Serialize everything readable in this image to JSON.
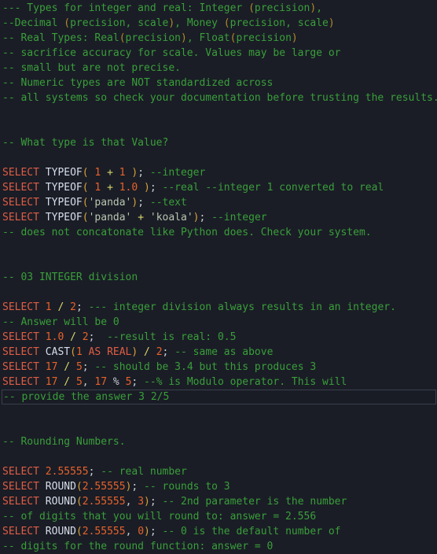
{
  "editor": {
    "app": "sql-code-editor",
    "language": "sql",
    "background_color": "#1a1d26",
    "active_line_index": 27,
    "colors": {
      "comment": "#3a9f3a",
      "keyword": "#e05d44",
      "function": "#d8dee9",
      "number": "#e8622a",
      "punctuation": "#d8a13a",
      "operator": "#d8d86a",
      "semicolon": "#c8cdd6",
      "string": "#b9c6b0",
      "active_line_border": "#3a3f4b"
    }
  },
  "lines": [
    {
      "n": 1,
      "text": "--- Types for integer and real: Integer (precision),",
      "tokens": [
        {
          "t": "--- Types for integer and real: Integer ",
          "c": "cmt"
        },
        {
          "t": "(",
          "c": "cmt-punc"
        },
        {
          "t": "precision",
          "c": "cmt"
        },
        {
          "t": ")",
          "c": "cmt-punc"
        },
        {
          "t": ",",
          "c": "cmt"
        }
      ]
    },
    {
      "n": 2,
      "text": "--Decimal (precision, scale), Money (precision, scale)",
      "tokens": [
        {
          "t": "--Decimal ",
          "c": "cmt"
        },
        {
          "t": "(",
          "c": "cmt-punc"
        },
        {
          "t": "precision, scale",
          "c": "cmt"
        },
        {
          "t": ")",
          "c": "cmt-punc"
        },
        {
          "t": ", Money ",
          "c": "cmt"
        },
        {
          "t": "(",
          "c": "cmt-punc"
        },
        {
          "t": "precision, scale",
          "c": "cmt"
        },
        {
          "t": ")",
          "c": "cmt-punc"
        }
      ]
    },
    {
      "n": 3,
      "text": "-- Real Types: Real(precision), Float(precision)",
      "tokens": [
        {
          "t": "-- Real Types: Real",
          "c": "cmt"
        },
        {
          "t": "(",
          "c": "cmt-punc"
        },
        {
          "t": "precision",
          "c": "cmt"
        },
        {
          "t": ")",
          "c": "cmt-punc"
        },
        {
          "t": ", Float",
          "c": "cmt"
        },
        {
          "t": "(",
          "c": "cmt-punc"
        },
        {
          "t": "precision",
          "c": "cmt"
        },
        {
          "t": ")",
          "c": "cmt-punc"
        }
      ]
    },
    {
      "n": 4,
      "text": "-- sacrifice accuracy for scale. Values may be large or",
      "tokens": [
        {
          "t": "-- sacrifice accuracy for scale. Values may be large or",
          "c": "cmt"
        }
      ]
    },
    {
      "n": 5,
      "text": "-- small but are not precise.",
      "tokens": [
        {
          "t": "-- small but are not precise.",
          "c": "cmt"
        }
      ]
    },
    {
      "n": 6,
      "text": "-- Numeric types are NOT standardized across",
      "tokens": [
        {
          "t": "-- Numeric types are NOT standardized across",
          "c": "cmt"
        }
      ]
    },
    {
      "n": 7,
      "text": "-- all systems so check your documentation before trusting the results.",
      "tokens": [
        {
          "t": "-- all systems so check your documentation before trusting the results.",
          "c": "cmt"
        }
      ]
    },
    {
      "n": 8,
      "text": "",
      "tokens": []
    },
    {
      "n": 9,
      "text": "",
      "tokens": []
    },
    {
      "n": 10,
      "text": "-- What type is that Value?",
      "tokens": [
        {
          "t": "-- What type is that Value?",
          "c": "cmt"
        }
      ]
    },
    {
      "n": 11,
      "text": "",
      "tokens": []
    },
    {
      "n": 12,
      "text": "SELECT TYPEOF( 1 + 1 ); --integer",
      "tokens": [
        {
          "t": "SELECT",
          "c": "kw"
        },
        {
          "t": " TYPEOF",
          "c": "fn"
        },
        {
          "t": "(",
          "c": "punc"
        },
        {
          "t": " ",
          "c": "plain"
        },
        {
          "t": "1",
          "c": "num"
        },
        {
          "t": " ",
          "c": "plain"
        },
        {
          "t": "+",
          "c": "op"
        },
        {
          "t": " ",
          "c": "plain"
        },
        {
          "t": "1",
          "c": "num"
        },
        {
          "t": " ",
          "c": "plain"
        },
        {
          "t": ")",
          "c": "punc"
        },
        {
          "t": ";",
          "c": "semi"
        },
        {
          "t": " ",
          "c": "plain"
        },
        {
          "t": "--integer",
          "c": "cmt"
        }
      ]
    },
    {
      "n": 13,
      "text": "SELECT TYPEOF( 1 + 1.0 ); --real --integer 1 converted to real",
      "tokens": [
        {
          "t": "SELECT",
          "c": "kw"
        },
        {
          "t": " TYPEOF",
          "c": "fn"
        },
        {
          "t": "(",
          "c": "punc"
        },
        {
          "t": " ",
          "c": "plain"
        },
        {
          "t": "1",
          "c": "num"
        },
        {
          "t": " ",
          "c": "plain"
        },
        {
          "t": "+",
          "c": "op"
        },
        {
          "t": " ",
          "c": "plain"
        },
        {
          "t": "1.0",
          "c": "num"
        },
        {
          "t": " ",
          "c": "plain"
        },
        {
          "t": ")",
          "c": "punc"
        },
        {
          "t": ";",
          "c": "semi"
        },
        {
          "t": " ",
          "c": "plain"
        },
        {
          "t": "--real --integer 1 converted to real",
          "c": "cmt"
        }
      ]
    },
    {
      "n": 14,
      "text": "SELECT TYPEOF('panda'); --text",
      "tokens": [
        {
          "t": "SELECT",
          "c": "kw"
        },
        {
          "t": " TYPEOF",
          "c": "fn"
        },
        {
          "t": "(",
          "c": "punc"
        },
        {
          "t": "'panda'",
          "c": "str"
        },
        {
          "t": ")",
          "c": "punc"
        },
        {
          "t": ";",
          "c": "semi"
        },
        {
          "t": " ",
          "c": "plain"
        },
        {
          "t": "--text",
          "c": "cmt"
        }
      ]
    },
    {
      "n": 15,
      "text": "SELECT TYPEOF('panda' + 'koala'); --integer",
      "tokens": [
        {
          "t": "SELECT",
          "c": "kw"
        },
        {
          "t": " TYPEOF",
          "c": "fn"
        },
        {
          "t": "(",
          "c": "punc"
        },
        {
          "t": "'panda'",
          "c": "str"
        },
        {
          "t": " ",
          "c": "plain"
        },
        {
          "t": "+",
          "c": "op"
        },
        {
          "t": " ",
          "c": "plain"
        },
        {
          "t": "'koala'",
          "c": "str"
        },
        {
          "t": ")",
          "c": "punc"
        },
        {
          "t": ";",
          "c": "semi"
        },
        {
          "t": " ",
          "c": "plain"
        },
        {
          "t": "--integer",
          "c": "cmt"
        }
      ]
    },
    {
      "n": 16,
      "text": "-- does not concatonate like Python does. Check your system.",
      "tokens": [
        {
          "t": "-- does not concatonate like Python does. Check your system.",
          "c": "cmt"
        }
      ]
    },
    {
      "n": 17,
      "text": "",
      "tokens": []
    },
    {
      "n": 18,
      "text": "",
      "tokens": []
    },
    {
      "n": 19,
      "text": "-- 03 INTEGER division",
      "tokens": [
        {
          "t": "-- 03 INTEGER division",
          "c": "cmt"
        }
      ]
    },
    {
      "n": 20,
      "text": "",
      "tokens": []
    },
    {
      "n": 21,
      "text": "SELECT 1 / 2; --- integer division always results in an integer.",
      "tokens": [
        {
          "t": "SELECT",
          "c": "kw"
        },
        {
          "t": " ",
          "c": "plain"
        },
        {
          "t": "1",
          "c": "num"
        },
        {
          "t": " ",
          "c": "plain"
        },
        {
          "t": "/",
          "c": "op"
        },
        {
          "t": " ",
          "c": "plain"
        },
        {
          "t": "2",
          "c": "num"
        },
        {
          "t": ";",
          "c": "semi"
        },
        {
          "t": " ",
          "c": "plain"
        },
        {
          "t": "--- integer division always results in an integer.",
          "c": "cmt"
        }
      ]
    },
    {
      "n": 22,
      "text": "-- Answer will be 0",
      "tokens": [
        {
          "t": "-- Answer will be 0",
          "c": "cmt"
        }
      ]
    },
    {
      "n": 23,
      "text": "SELECT 1.0 / 2;  --result is real: 0.5",
      "tokens": [
        {
          "t": "SELECT",
          "c": "kw"
        },
        {
          "t": " ",
          "c": "plain"
        },
        {
          "t": "1.0",
          "c": "num"
        },
        {
          "t": " ",
          "c": "plain"
        },
        {
          "t": "/",
          "c": "op"
        },
        {
          "t": " ",
          "c": "plain"
        },
        {
          "t": "2",
          "c": "num"
        },
        {
          "t": ";",
          "c": "semi"
        },
        {
          "t": "  ",
          "c": "plain"
        },
        {
          "t": "--result is real: 0.5",
          "c": "cmt"
        }
      ]
    },
    {
      "n": 24,
      "text": "SELECT CAST(1 AS REAL) / 2; -- same as above",
      "tokens": [
        {
          "t": "SELECT",
          "c": "kw"
        },
        {
          "t": " CAST",
          "c": "fn"
        },
        {
          "t": "(",
          "c": "punc"
        },
        {
          "t": "1",
          "c": "num"
        },
        {
          "t": " ",
          "c": "plain"
        },
        {
          "t": "AS REAL",
          "c": "kw"
        },
        {
          "t": ")",
          "c": "punc"
        },
        {
          "t": " ",
          "c": "plain"
        },
        {
          "t": "/",
          "c": "op"
        },
        {
          "t": " ",
          "c": "plain"
        },
        {
          "t": "2",
          "c": "num"
        },
        {
          "t": ";",
          "c": "semi"
        },
        {
          "t": " ",
          "c": "plain"
        },
        {
          "t": "-- same as above",
          "c": "cmt"
        }
      ]
    },
    {
      "n": 25,
      "text": "SELECT 17 / 5; -- should be 3.4 but this produces 3",
      "tokens": [
        {
          "t": "SELECT",
          "c": "kw"
        },
        {
          "t": " ",
          "c": "plain"
        },
        {
          "t": "17",
          "c": "num"
        },
        {
          "t": " ",
          "c": "plain"
        },
        {
          "t": "/",
          "c": "op"
        },
        {
          "t": " ",
          "c": "plain"
        },
        {
          "t": "5",
          "c": "num"
        },
        {
          "t": ";",
          "c": "semi"
        },
        {
          "t": " ",
          "c": "plain"
        },
        {
          "t": "-- should be 3.4 but this produces 3",
          "c": "cmt"
        }
      ]
    },
    {
      "n": 26,
      "text": "SELECT 17 / 5, 17 % 5; --% is Modulo operator. This will",
      "tokens": [
        {
          "t": "SELECT",
          "c": "kw"
        },
        {
          "t": " ",
          "c": "plain"
        },
        {
          "t": "17",
          "c": "num"
        },
        {
          "t": " ",
          "c": "plain"
        },
        {
          "t": "/",
          "c": "op"
        },
        {
          "t": " ",
          "c": "plain"
        },
        {
          "t": "5",
          "c": "num"
        },
        {
          "t": ", ",
          "c": "semi"
        },
        {
          "t": "17",
          "c": "num"
        },
        {
          "t": " ",
          "c": "plain"
        },
        {
          "t": "%",
          "c": "semi"
        },
        {
          "t": " ",
          "c": "plain"
        },
        {
          "t": "5",
          "c": "num"
        },
        {
          "t": ";",
          "c": "semi"
        },
        {
          "t": " ",
          "c": "plain"
        },
        {
          "t": "--% is Modulo operator. This will",
          "c": "cmt"
        }
      ]
    },
    {
      "n": 27,
      "text": "-- provide the answer 3 2/5",
      "active": true,
      "tokens": [
        {
          "t": "-- provide the answer 3 2/5",
          "c": "cmt"
        }
      ]
    },
    {
      "n": 28,
      "text": "",
      "tokens": []
    },
    {
      "n": 29,
      "text": "",
      "tokens": []
    },
    {
      "n": 30,
      "text": "-- Rounding Numbers.",
      "tokens": [
        {
          "t": "-- Rounding Numbers.",
          "c": "cmt"
        }
      ]
    },
    {
      "n": 31,
      "text": "",
      "tokens": []
    },
    {
      "n": 32,
      "text": "SELECT 2.55555; -- real number",
      "tokens": [
        {
          "t": "SELECT",
          "c": "kw"
        },
        {
          "t": " ",
          "c": "plain"
        },
        {
          "t": "2.55555",
          "c": "num"
        },
        {
          "t": ";",
          "c": "semi"
        },
        {
          "t": " ",
          "c": "plain"
        },
        {
          "t": "-- real number",
          "c": "cmt"
        }
      ]
    },
    {
      "n": 33,
      "text": "SELECT ROUND(2.55555); -- rounds to 3",
      "tokens": [
        {
          "t": "SELECT",
          "c": "kw"
        },
        {
          "t": " ROUND",
          "c": "fn"
        },
        {
          "t": "(",
          "c": "punc"
        },
        {
          "t": "2.55555",
          "c": "num"
        },
        {
          "t": ")",
          "c": "punc"
        },
        {
          "t": ";",
          "c": "semi"
        },
        {
          "t": " ",
          "c": "plain"
        },
        {
          "t": "-- rounds to 3",
          "c": "cmt"
        }
      ]
    },
    {
      "n": 34,
      "text": "SELECT ROUND(2.55555, 3); -- 2nd parameter is the number",
      "tokens": [
        {
          "t": "SELECT",
          "c": "kw"
        },
        {
          "t": " ROUND",
          "c": "fn"
        },
        {
          "t": "(",
          "c": "punc"
        },
        {
          "t": "2.55555",
          "c": "num"
        },
        {
          "t": ", ",
          "c": "semi"
        },
        {
          "t": "3",
          "c": "num"
        },
        {
          "t": ")",
          "c": "punc"
        },
        {
          "t": ";",
          "c": "semi"
        },
        {
          "t": " ",
          "c": "plain"
        },
        {
          "t": "-- 2nd parameter is the number",
          "c": "cmt"
        }
      ]
    },
    {
      "n": 35,
      "text": "-- of digits that you will round to: answer = 2.556",
      "tokens": [
        {
          "t": "-- of digits that you will round to: answer = 2.556",
          "c": "cmt"
        }
      ]
    },
    {
      "n": 36,
      "text": "SELECT ROUND(2.55555, 0); -- 0 is the default number of",
      "tokens": [
        {
          "t": "SELECT",
          "c": "kw"
        },
        {
          "t": " ROUND",
          "c": "fn"
        },
        {
          "t": "(",
          "c": "punc"
        },
        {
          "t": "2.55555",
          "c": "num"
        },
        {
          "t": ", ",
          "c": "semi"
        },
        {
          "t": "0",
          "c": "num"
        },
        {
          "t": ")",
          "c": "punc"
        },
        {
          "t": ";",
          "c": "semi"
        },
        {
          "t": " ",
          "c": "plain"
        },
        {
          "t": "-- 0 is the default number of",
          "c": "cmt"
        }
      ]
    },
    {
      "n": 37,
      "text": "-- digits for the round function: answer = 0",
      "tokens": [
        {
          "t": "-- digits for the round function: answer = 0",
          "c": "cmt"
        }
      ]
    }
  ]
}
